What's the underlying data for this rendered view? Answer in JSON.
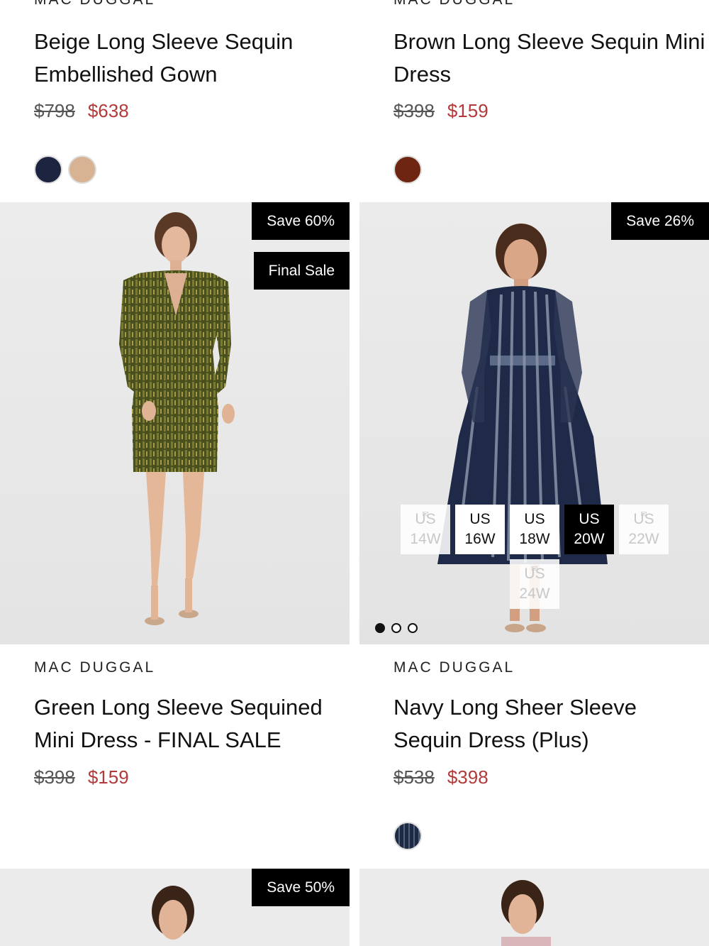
{
  "row1": {
    "left": {
      "brand": "MAC DUGGAL",
      "title": "Beige Long Sleeve Sequin Embellished Gown",
      "price_original": "$798",
      "price_sale": "$638",
      "swatches": [
        "#1c2440",
        "#d7b393"
      ]
    },
    "right": {
      "brand": "MAC DUGGAL",
      "title": "Brown Long Sleeve Sequin Mini Dress",
      "price_original": "$398",
      "price_sale": "$159",
      "swatches": [
        "#6e2612"
      ]
    }
  },
  "row2": {
    "left": {
      "badges": [
        "Save 60%",
        "Final Sale"
      ],
      "brand": "MAC DUGGAL",
      "title": "Green Long Sleeve Sequined Mini Dress - FINAL SALE",
      "price_original": "$398",
      "price_sale": "$159"
    },
    "right": {
      "badges": [
        "Save 26%"
      ],
      "sizes": [
        {
          "label": "US 14W",
          "state": "unavailable"
        },
        {
          "label": "US 16W",
          "state": "available"
        },
        {
          "label": "US 18W",
          "state": "available"
        },
        {
          "label": "US 20W",
          "state": "selected"
        },
        {
          "label": "US 22W",
          "state": "unavailable"
        },
        {
          "label": "US 24W",
          "state": "unavailable"
        }
      ],
      "carousel_active_index": 0,
      "carousel_count": 3,
      "brand": "MAC DUGGAL",
      "title": "Navy Long Sheer Sleeve Sequin Dress (Plus)",
      "price_original": "$538",
      "price_sale": "$398",
      "swatches": [
        "#1d2a44"
      ]
    }
  },
  "row3": {
    "left": {
      "badges": [
        "Save 50%"
      ]
    }
  },
  "colors": {
    "sale_price": "#b23a3a",
    "badge_bg": "#000000",
    "card_bg": "#e9e9e9"
  }
}
